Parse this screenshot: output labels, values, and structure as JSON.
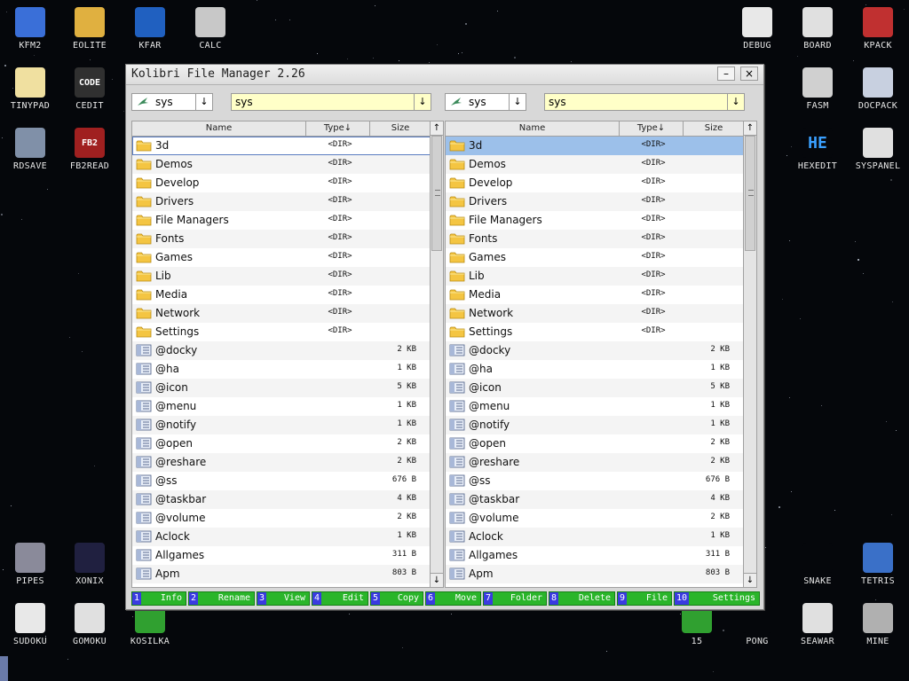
{
  "window": {
    "title": "Kolibri File Manager 2.26",
    "minimize": "–",
    "close": "×"
  },
  "desktop_icons": [
    {
      "label": "KFM2",
      "color": "#3a6fd8",
      "glyph": ""
    },
    {
      "label": "EOLITE",
      "color": "#e0b040",
      "glyph": ""
    },
    {
      "label": "KFAR",
      "color": "#2060c0",
      "glyph": ""
    },
    {
      "label": "CALC",
      "color": "#c8c8c8",
      "glyph": ""
    },
    {
      "label": "TINYPAD",
      "color": "#f0e0a0",
      "glyph": ""
    },
    {
      "label": "CEDIT",
      "color": "#303030",
      "glyph": "CODE"
    },
    {
      "label": "RDSAVE",
      "color": "#8090a8",
      "glyph": ""
    },
    {
      "label": "FB2READ",
      "color": "#a02020",
      "glyph": "FB2"
    },
    {
      "label": "PIPES",
      "color": "#8a8a9a",
      "glyph": ""
    },
    {
      "label": "XONIX",
      "color": "#202040",
      "glyph": ""
    },
    {
      "label": "SUDOKU",
      "color": "#e8e8e8",
      "glyph": ""
    },
    {
      "label": "GOMOKU",
      "color": "#e0e0e0",
      "glyph": ""
    },
    {
      "label": "KOSILKA",
      "color": "#30a030",
      "glyph": ""
    },
    {
      "label": "DEBUG",
      "color": "#e8e8e8",
      "glyph": ""
    },
    {
      "label": "BOARD",
      "color": "#e0e0e0",
      "glyph": ""
    },
    {
      "label": "KPACK",
      "color": "#c03030",
      "glyph": ""
    },
    {
      "label": "FASM",
      "color": "#d0d0d0",
      "glyph": ""
    },
    {
      "label": "DOCPACK",
      "color": "#c8d0e0",
      "glyph": ""
    },
    {
      "label": "HEXEDIT",
      "color": "#05070b",
      "glyph": "HE"
    },
    {
      "label": "SYSPANEL",
      "color": "#e0e0e0",
      "glyph": ""
    },
    {
      "label": "SNAKE",
      "color": "#05070b",
      "glyph": ""
    },
    {
      "label": "TETRIS",
      "color": "#3a70c8",
      "glyph": ""
    },
    {
      "label": "15",
      "color": "#30a030",
      "glyph": ""
    },
    {
      "label": "PONG",
      "color": "#05070b",
      "glyph": ""
    },
    {
      "label": "SEAWAR",
      "color": "#e0e0e0",
      "glyph": ""
    },
    {
      "label": "MINE",
      "color": "#b0b0b0",
      "glyph": ""
    }
  ],
  "left_panel": {
    "drive": "sys",
    "path": "sys",
    "columns": {
      "name": "Name",
      "type": "Type↓",
      "size": "Size"
    },
    "scroll_up": "↑",
    "scroll_down": "↓",
    "selected_index": 0
  },
  "right_panel": {
    "drive": "sys",
    "path": "sys",
    "columns": {
      "name": "Name",
      "type": "Type↓",
      "size": "Size"
    },
    "scroll_up": "↑",
    "scroll_down": "↓",
    "selected_index": 0
  },
  "files": [
    {
      "name": "3d",
      "type": "<DIR>",
      "size": "",
      "kind": "folder"
    },
    {
      "name": "Demos",
      "type": "<DIR>",
      "size": "",
      "kind": "folder"
    },
    {
      "name": "Develop",
      "type": "<DIR>",
      "size": "",
      "kind": "folder"
    },
    {
      "name": "Drivers",
      "type": "<DIR>",
      "size": "",
      "kind": "folder"
    },
    {
      "name": "File Managers",
      "type": "<DIR>",
      "size": "",
      "kind": "folder"
    },
    {
      "name": "Fonts",
      "type": "<DIR>",
      "size": "",
      "kind": "folder"
    },
    {
      "name": "Games",
      "type": "<DIR>",
      "size": "",
      "kind": "folder"
    },
    {
      "name": "Lib",
      "type": "<DIR>",
      "size": "",
      "kind": "folder"
    },
    {
      "name": "Media",
      "type": "<DIR>",
      "size": "",
      "kind": "folder"
    },
    {
      "name": "Network",
      "type": "<DIR>",
      "size": "",
      "kind": "folder"
    },
    {
      "name": "Settings",
      "type": "<DIR>",
      "size": "",
      "kind": "folder"
    },
    {
      "name": "@docky",
      "type": "",
      "size": "2 KB",
      "kind": "file"
    },
    {
      "name": "@ha",
      "type": "",
      "size": "1 KB",
      "kind": "file"
    },
    {
      "name": "@icon",
      "type": "",
      "size": "5 KB",
      "kind": "file"
    },
    {
      "name": "@menu",
      "type": "",
      "size": "1 KB",
      "kind": "file"
    },
    {
      "name": "@notify",
      "type": "",
      "size": "1 KB",
      "kind": "file"
    },
    {
      "name": "@open",
      "type": "",
      "size": "2 KB",
      "kind": "file"
    },
    {
      "name": "@reshare",
      "type": "",
      "size": "2 KB",
      "kind": "file"
    },
    {
      "name": "@ss",
      "type": "",
      "size": "676 B",
      "kind": "file"
    },
    {
      "name": "@taskbar",
      "type": "",
      "size": "4 KB",
      "kind": "file"
    },
    {
      "name": "@volume",
      "type": "",
      "size": "2 KB",
      "kind": "file"
    },
    {
      "name": "Aclock",
      "type": "",
      "size": "1 KB",
      "kind": "file"
    },
    {
      "name": "Allgames",
      "type": "",
      "size": "311 B",
      "kind": "file"
    },
    {
      "name": "Apm",
      "type": "",
      "size": "803 B",
      "kind": "file"
    }
  ],
  "function_keys": [
    {
      "num": "1",
      "label": "Info"
    },
    {
      "num": "2",
      "label": "Rename"
    },
    {
      "num": "3",
      "label": "View"
    },
    {
      "num": "4",
      "label": "Edit"
    },
    {
      "num": "5",
      "label": "Copy"
    },
    {
      "num": "6",
      "label": "Move"
    },
    {
      "num": "7",
      "label": "Folder"
    },
    {
      "num": "8",
      "label": "Delete"
    },
    {
      "num": "9",
      "label": "File"
    },
    {
      "num": "10",
      "label": "Settings"
    }
  ]
}
